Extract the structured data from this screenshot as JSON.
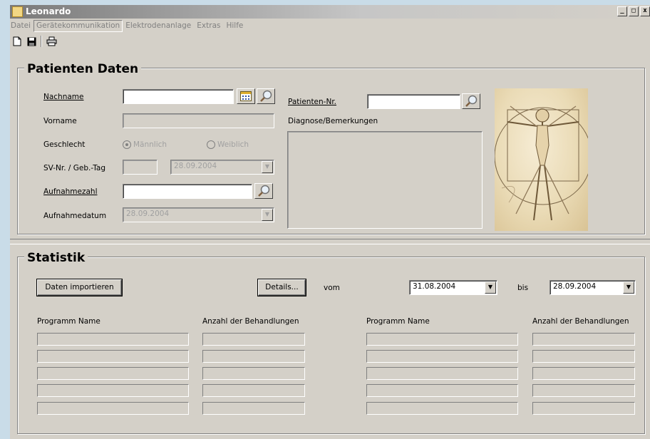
{
  "window": {
    "title": "Leonardo",
    "controls": {
      "minimize": "_",
      "maximize": "□",
      "close": "x"
    }
  },
  "menu": [
    "Datei",
    "Gerätekommunikation",
    "Elektrodenanlage",
    "Extras",
    "Hilfe"
  ],
  "toolbar": {
    "buttons": [
      "new-icon",
      "save-icon",
      "print-icon"
    ]
  },
  "patient": {
    "title": "Patienten Daten",
    "nachname_label": "Nachname",
    "nachname_value": "",
    "vorname_label": "Vorname",
    "vorname_value": "",
    "geschlecht_label": "Geschlecht",
    "maennlich_label": "Männlich",
    "weiblich_label": "Weiblich",
    "selected_gender": "Männlich",
    "sv_label": "SV-Nr. / Geb.-Tag",
    "sv_value": "",
    "geb_tag_value": "28.09.2004",
    "aufnahmezahl_label": "Aufnahmezahl",
    "aufnahmezahl_value": "",
    "aufnahmedatum_label": "Aufnahmedatum",
    "aufnahmedatum_value": "28.09.2004",
    "patienten_nr_label": "Patienten-Nr.",
    "patienten_nr_value": "",
    "diagnose_label": "Diagnose/Bemerkungen",
    "diagnose_value": ""
  },
  "statistik": {
    "title": "Statistik",
    "import_button": "Daten importieren",
    "details_button": "Details...",
    "vom_label": "vom",
    "vom_value": "31.08.2004",
    "bis_label": "bis",
    "bis_value": "28.09.2004",
    "col_program_left": "Programm Name",
    "col_count_left": "Anzahl der Behandlungen",
    "col_program_right": "Programm Name",
    "col_count_right": "Anzahl der Behandlungen",
    "rows": [
      "",
      "",
      "",
      "",
      ""
    ]
  }
}
